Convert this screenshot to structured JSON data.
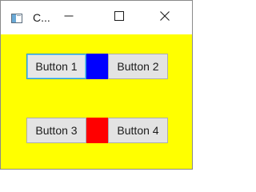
{
  "window": {
    "title": "C...",
    "icons": {
      "app": "window-app-icon",
      "minimize": "minimize-icon",
      "maximize": "maximize-icon",
      "close": "close-icon"
    }
  },
  "colors": {
    "client_background": "#ffff00",
    "swatch_row_1": "#0000ff",
    "swatch_row_2": "#ff0000",
    "button_face": "#e3e3e3",
    "focus_border": "#2a9ad6"
  },
  "buttons": [
    {
      "label": "Button 1",
      "focused": true
    },
    {
      "label": "Button 2",
      "focused": false
    },
    {
      "label": "Button 3",
      "focused": false
    },
    {
      "label": "Button 4",
      "focused": false
    }
  ]
}
